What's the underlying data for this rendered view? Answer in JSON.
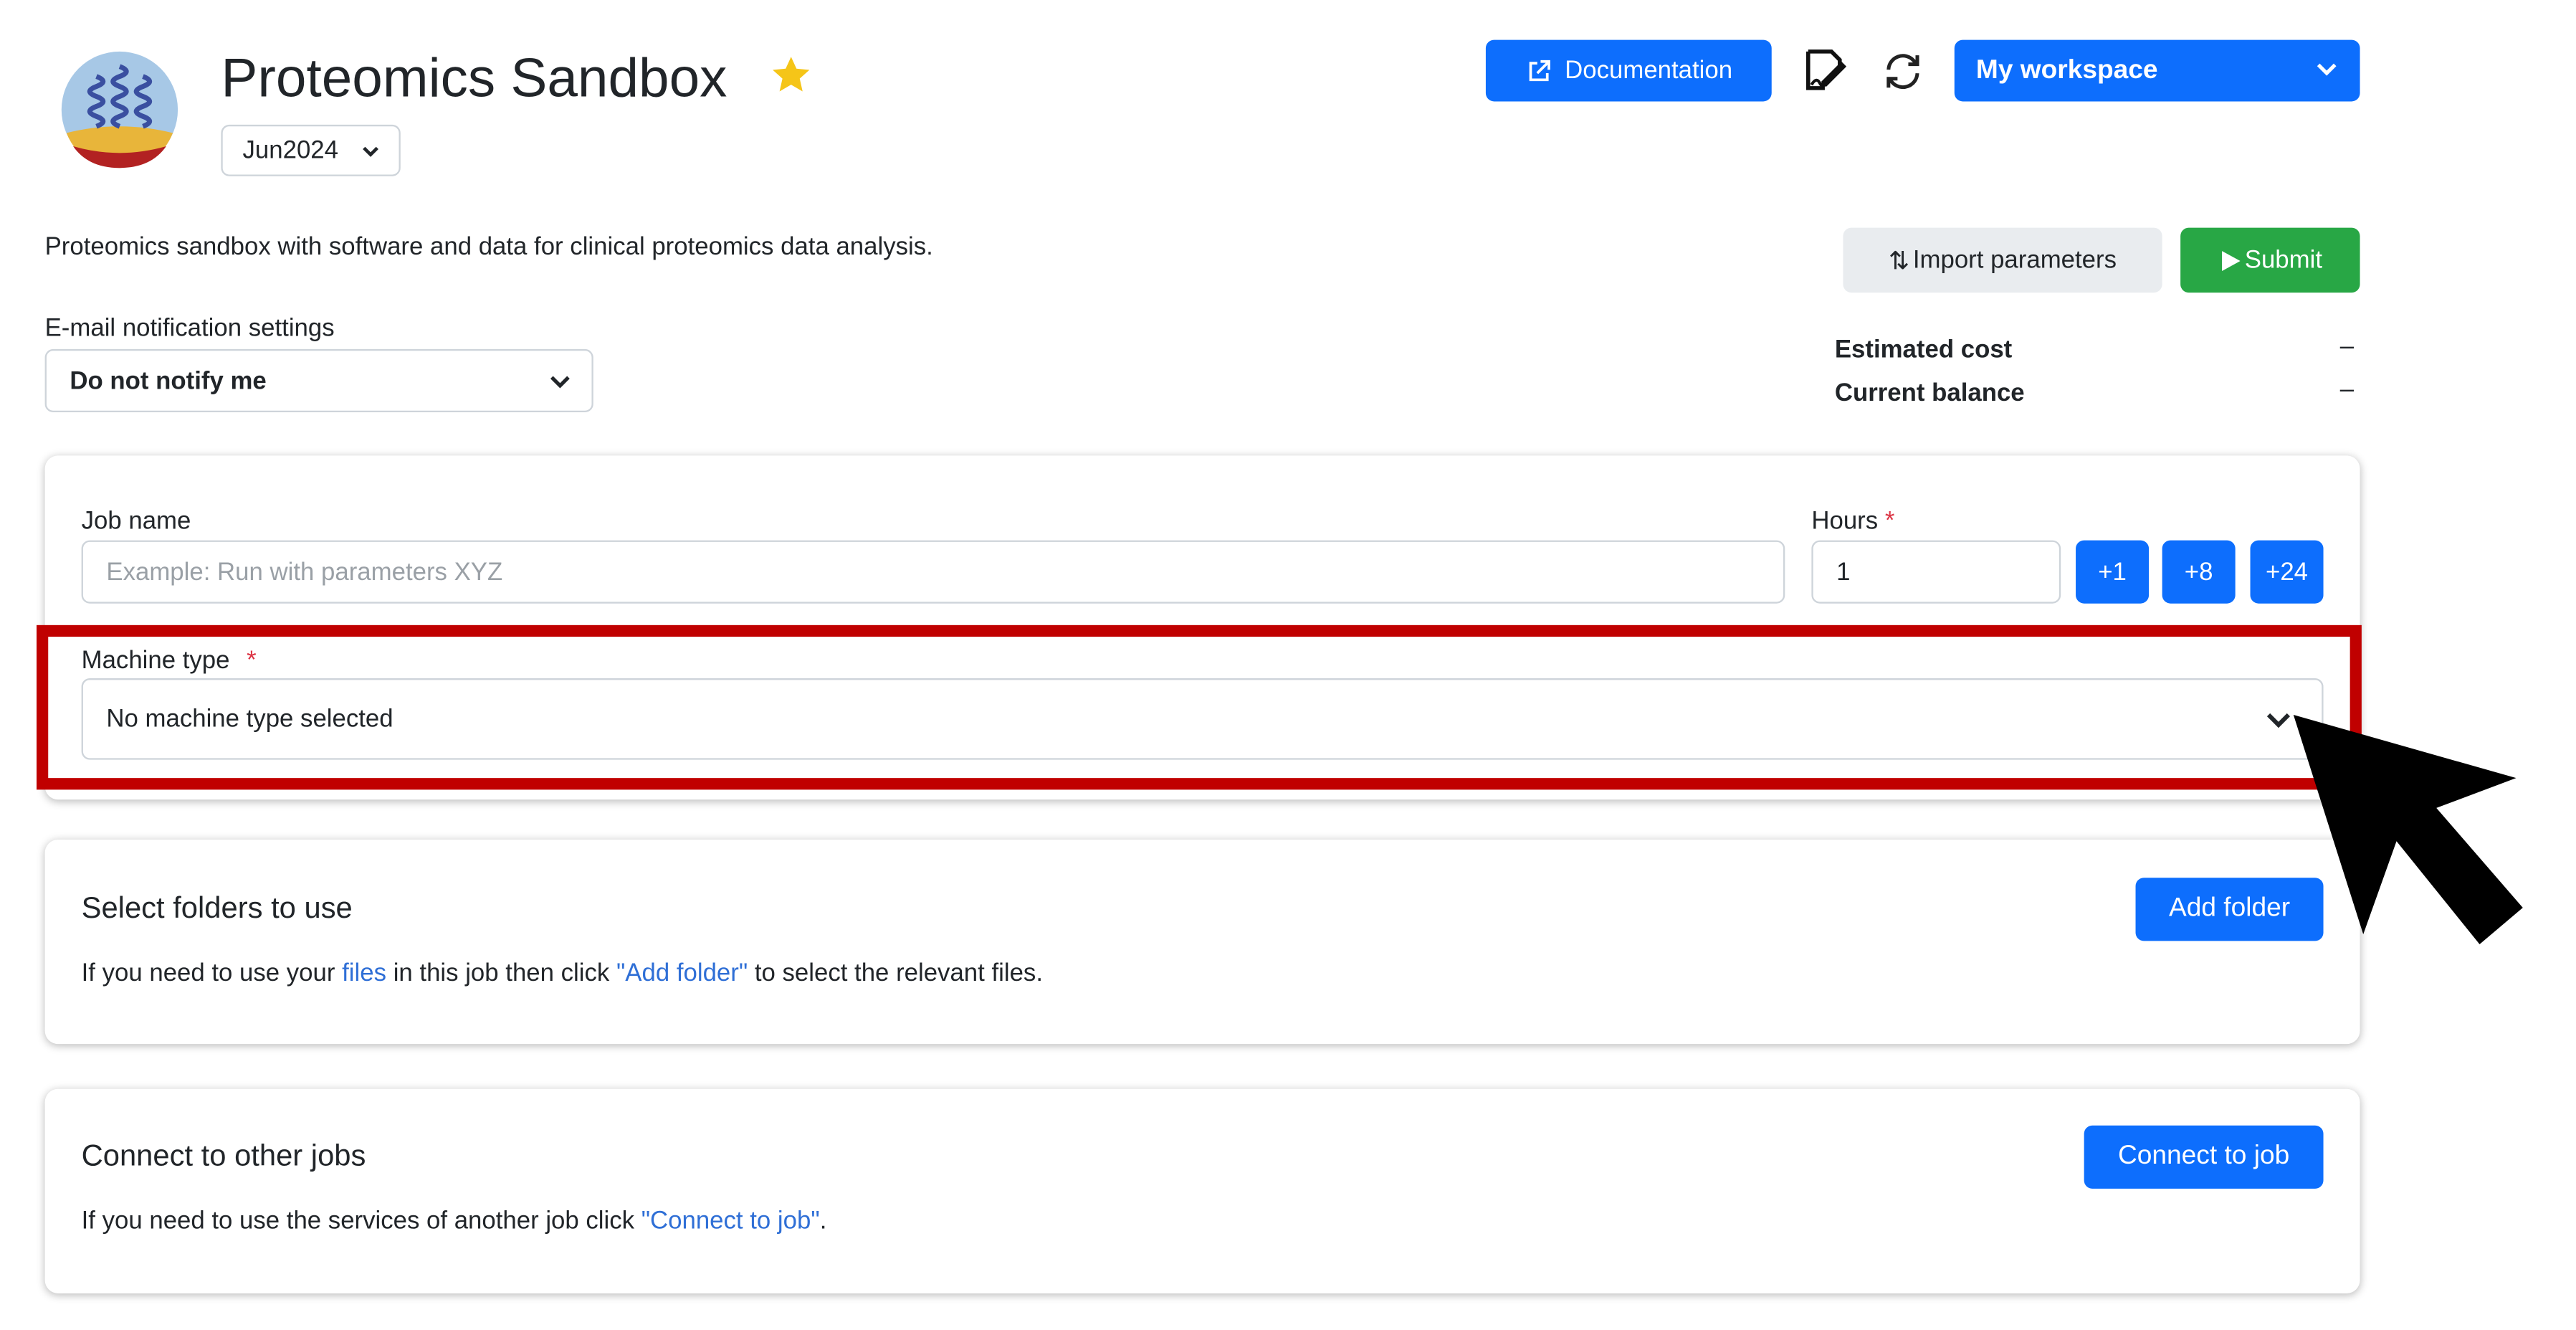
{
  "header": {
    "logo_icon": "protein-helix-logo",
    "title": "Proteomics Sandbox",
    "favorite_icon": "star-icon",
    "favorite_color": "#f5c518",
    "version": "Jun2024",
    "documentation_label": "Documentation",
    "workspace": "My workspace"
  },
  "description": "Proteomics sandbox with software and data for clinical proteomics data analysis.",
  "actions": {
    "import_label": "Import parameters",
    "submit_label": "Submit"
  },
  "email": {
    "label": "E-mail notification settings",
    "value": "Do not notify me"
  },
  "cost": {
    "estimated_label": "Estimated cost",
    "estimated_value": "–",
    "balance_label": "Current balance",
    "balance_value": "–"
  },
  "job": {
    "name_label": "Job name",
    "name_placeholder": "Example: Run with parameters XYZ",
    "hours_label": "Hours",
    "required_mark": "*",
    "hours_value": "1",
    "hour_buttons": [
      "+1",
      "+8",
      "+24"
    ],
    "machine_label": "Machine type",
    "machine_value": "No machine type selected"
  },
  "folders": {
    "title": "Select folders to use",
    "text_prefix": "If you need to use your ",
    "text_link": "files",
    "text_middle": " in this job then click ",
    "text_quote": "\"Add folder\"",
    "text_suffix": " to select the relevant files.",
    "button": "Add folder"
  },
  "connect": {
    "title": "Connect to other jobs",
    "text_prefix": "If you need to use the services of another job click ",
    "text_quote": "\"Connect to job\"",
    "text_suffix": ".",
    "button": "Connect to job"
  },
  "colors": {
    "primary": "#0d6efd",
    "success": "#28a745",
    "highlight": "#c00000"
  }
}
